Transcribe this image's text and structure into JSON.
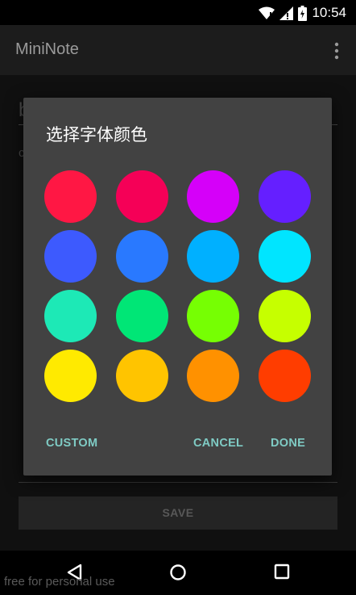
{
  "status_bar": {
    "time": "10:54",
    "icons": [
      "wifi-icon",
      "cell-signal-icon",
      "battery-icon"
    ]
  },
  "app_bar": {
    "title": "MiniNote",
    "menu_icon": "overflow-menu-icon"
  },
  "editor": {
    "title_value": "b",
    "body_value": "c",
    "save_label": "SAVE"
  },
  "dialog": {
    "title": "选择字体颜色",
    "colors": [
      "#ff1744",
      "#f50057",
      "#d500f9",
      "#651fff",
      "#3d5afe",
      "#2979ff",
      "#00b0ff",
      "#00e5ff",
      "#1de9b6",
      "#00e676",
      "#76ff03",
      "#c6ff00",
      "#ffea00",
      "#ffc400",
      "#ff9100",
      "#ff3d00"
    ],
    "custom_label": "CUSTOM",
    "cancel_label": "CANCEL",
    "done_label": "DONE",
    "accent_color": "#7fcbc4"
  },
  "nav_bar": {
    "icons": [
      "back-icon",
      "home-icon",
      "recents-icon"
    ]
  },
  "watermark": "free for personal use"
}
